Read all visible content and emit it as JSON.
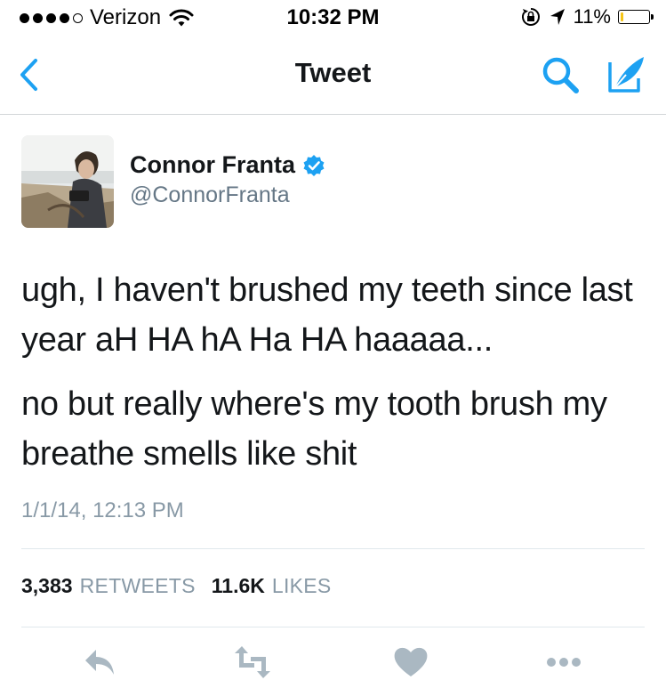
{
  "status_bar": {
    "carrier": "Verizon",
    "time": "10:32 PM",
    "battery_percent": "11%",
    "battery_level": 0.11,
    "signal_bars_filled": 4,
    "signal_bars_total": 5,
    "icons": [
      "wifi-icon",
      "rotation-lock-icon",
      "location-arrow-icon",
      "battery-icon"
    ]
  },
  "nav": {
    "title": "Tweet",
    "icons": [
      "back-chevron-icon",
      "search-icon",
      "compose-tweet-icon"
    ]
  },
  "tweet": {
    "author_name": "Connor Franta",
    "author_handle": "@ConnorFranta",
    "verified": true,
    "paragraphs": [
      "ugh, I haven't brushed my teeth since last year aH HA hA Ha HA haaaaa...",
      "no but really where's my tooth brush my breathe smells like shit"
    ],
    "timestamp": "1/1/14, 12:13 PM"
  },
  "stats": {
    "retweets_count": "3,383",
    "retweets_label": "RETWEETS",
    "likes_count": "11.6K",
    "likes_label": "LIKES"
  },
  "actions": [
    "reply-icon",
    "retweet-icon",
    "like-icon",
    "more-icon"
  ],
  "colors": {
    "accent": "#1da1f2",
    "text": "#14171a",
    "secondary": "#657786",
    "muted": "#8899a6",
    "divider": "#e1e8ed"
  }
}
